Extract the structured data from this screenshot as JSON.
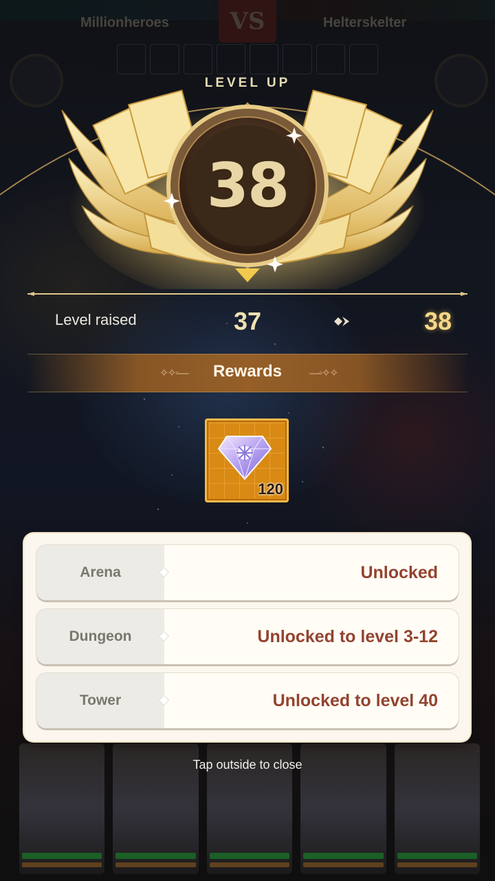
{
  "background": {
    "teams": {
      "left": "Millionheroes",
      "right": "Helterskelter"
    },
    "vs_label": "VS"
  },
  "level_up": {
    "title": "LEVEL UP",
    "level": "38"
  },
  "level_raised": {
    "label": "Level raised",
    "from": "37",
    "to": "38"
  },
  "rewards": {
    "title": "Rewards",
    "items": [
      {
        "icon": "diamond-gem-icon",
        "quantity": "120"
      }
    ]
  },
  "unlocks": [
    {
      "feature": "Arena",
      "status": "Unlocked"
    },
    {
      "feature": "Dungeon",
      "status": "Unlocked to level 3-12"
    },
    {
      "feature": "Tower",
      "status": "Unlocked to level 40"
    }
  ],
  "close_hint": "Tap outside to close",
  "colors": {
    "gold_text": "#f6d888",
    "status_text": "#93432e",
    "reward_bg": "#d98a14"
  }
}
